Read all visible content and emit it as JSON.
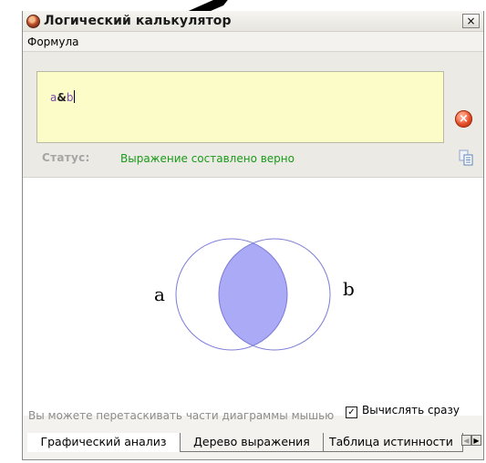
{
  "window": {
    "title": "Логический калькулятор",
    "close_glyph": "×"
  },
  "menu": {
    "items": [
      "Формула"
    ]
  },
  "formula": {
    "operand_a": "a",
    "operator": "&",
    "operand_b": "b",
    "clear_glyph": "×"
  },
  "status": {
    "label": "Статус:",
    "text": "Выражение составлено верно"
  },
  "diagram": {
    "label_a": "a",
    "label_b": "b",
    "fill_color": "#aaaaf7",
    "outline_color": "#7b7bd6",
    "hint": "Вы можете перетаскивать части диаграммы мышью",
    "checkbox_label": "Вычислять сразу",
    "checkbox_checked": true,
    "check_glyph": "✓"
  },
  "tabs": [
    {
      "label": "Графический анализ",
      "active": true
    },
    {
      "label": "Дерево выражения",
      "active": false
    },
    {
      "label": "Таблица истинности",
      "active": false
    }
  ],
  "tab_scroll": {
    "left_glyph": "◀",
    "right_glyph": "▶"
  },
  "icons": {
    "app": "app-icon",
    "close": "close-icon",
    "clear": "clear-icon",
    "copy": "copy-icon",
    "cursor": "mouse-pointer-icon"
  }
}
